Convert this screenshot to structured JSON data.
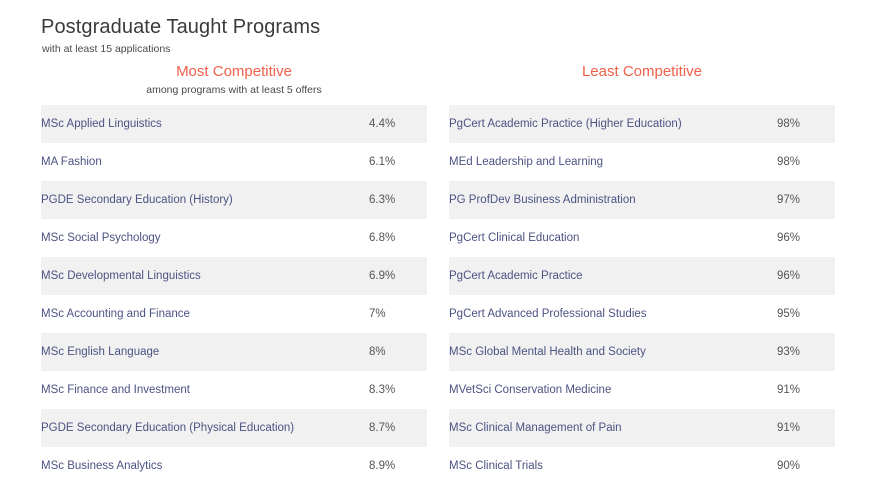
{
  "header": {
    "title": "Postgraduate Taught Programs",
    "subtitle": "with at least 15 applications"
  },
  "colors": {
    "heading": "#f0604a",
    "program_name": "#4c5382",
    "value": "#555555",
    "row_stripe": "#f1f1f1",
    "title": "#3b3b3b"
  },
  "columns": [
    {
      "heading": "Most Competitive",
      "subheading": "among programs with at least 5 offers",
      "rows": [
        {
          "name": "MSc Applied Linguistics",
          "value": "4.4%"
        },
        {
          "name": "MA Fashion",
          "value": "6.1%"
        },
        {
          "name": "PGDE Secondary Education (History)",
          "value": "6.3%"
        },
        {
          "name": "MSc Social Psychology",
          "value": "6.8%"
        },
        {
          "name": "MSc Developmental Linguistics",
          "value": "6.9%"
        },
        {
          "name": "MSc Accounting and Finance",
          "value": "7%"
        },
        {
          "name": "MSc English Language",
          "value": "8%"
        },
        {
          "name": "MSc Finance and Investment",
          "value": "8.3%"
        },
        {
          "name": "PGDE Secondary Education (Physical Education)",
          "value": "8.7%"
        },
        {
          "name": "MSc Business Analytics",
          "value": "8.9%"
        }
      ]
    },
    {
      "heading": "Least Competitive",
      "subheading": "",
      "rows": [
        {
          "name": "PgCert Academic Practice (Higher Education)",
          "value": "98%"
        },
        {
          "name": "MEd Leadership and Learning",
          "value": "98%"
        },
        {
          "name": "PG ProfDev Business Administration",
          "value": "97%"
        },
        {
          "name": "PgCert Clinical Education",
          "value": "96%"
        },
        {
          "name": "PgCert Academic Practice",
          "value": "96%"
        },
        {
          "name": "PgCert Advanced Professional Studies",
          "value": "95%"
        },
        {
          "name": "MSc Global Mental Health and Society",
          "value": "93%"
        },
        {
          "name": "MVetSci Conservation Medicine",
          "value": "91%"
        },
        {
          "name": "MSc Clinical Management of Pain",
          "value": "91%"
        },
        {
          "name": "MSc Clinical Trials",
          "value": "90%"
        }
      ]
    }
  ]
}
